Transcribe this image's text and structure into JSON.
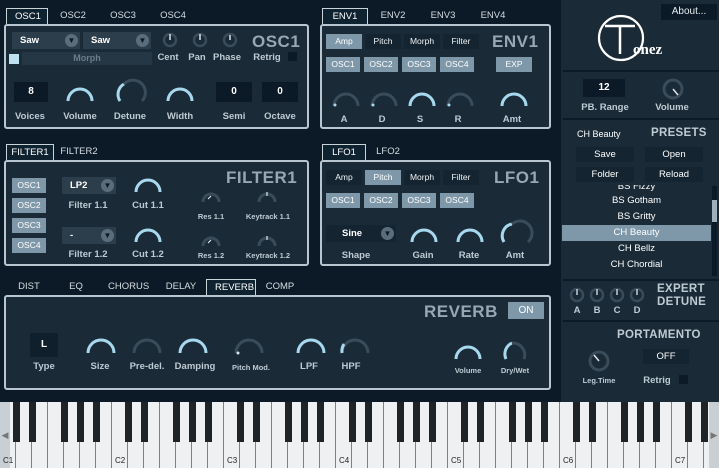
{
  "osc": {
    "tabs": [
      "OSC1",
      "OSC2",
      "OSC3",
      "OSC4"
    ],
    "title": "OSC1",
    "wave1": "Saw",
    "wave2": "Saw",
    "morph_label": "Morph",
    "knob_labels": [
      "Cent",
      "Pan",
      "Phase",
      "Retrig"
    ],
    "voices_value": "8",
    "semi_value": "0",
    "octave_value": "0",
    "bottom_labels": [
      "Voices",
      "Volume",
      "Detune",
      "Width",
      "Semi",
      "Octave"
    ]
  },
  "env": {
    "tabs": [
      "ENV1",
      "ENV2",
      "ENV3",
      "ENV4"
    ],
    "title": "ENV1",
    "targets": [
      "Amp",
      "Pitch",
      "Morph",
      "Filter"
    ],
    "oscs": [
      "OSC1",
      "OSC2",
      "OSC3",
      "OSC4"
    ],
    "exp": "EXP",
    "knob_labels": [
      "A",
      "D",
      "S",
      "R",
      "Amt"
    ]
  },
  "filter": {
    "tabs": [
      "FILTER1",
      "FILTER2"
    ],
    "title": "FILTER1",
    "oscs": [
      "OSC1",
      "OSC2",
      "OSC3",
      "OSC4"
    ],
    "type1": "LP2",
    "type2": "-",
    "labels": [
      "Filter 1.1",
      "Cut 1.1",
      "Res 1.1",
      "Keytrack 1.1",
      "Filter 1.2",
      "Cut 1.2",
      "Res 1.2",
      "Keytrack 1.2"
    ]
  },
  "lfo": {
    "tabs": [
      "LFO1",
      "LFO2"
    ],
    "title": "LFO1",
    "targets": [
      "Amp",
      "Pitch",
      "Morph",
      "Filter"
    ],
    "oscs": [
      "OSC1",
      "OSC2",
      "OSC3",
      "OSC4"
    ],
    "shape": "Sine",
    "labels": [
      "Shape",
      "Gain",
      "Rate",
      "Amt"
    ]
  },
  "fx": {
    "tabs": [
      "DIST",
      "EQ",
      "CHORUS",
      "DELAY",
      "REVERB",
      "COMP"
    ],
    "title": "REVERB",
    "on": "ON",
    "type_value": "L",
    "labels": [
      "Type",
      "Size",
      "Pre-del.",
      "Damping",
      "Pitch Mod.",
      "LPF",
      "HPF",
      "Volume",
      "Dry/Wet"
    ]
  },
  "side": {
    "about": "About...",
    "logo": "TONEZ",
    "pb_value": "12",
    "pb_label": "PB. Range",
    "volume_label": "Volume",
    "preset_name": "CH Beauty",
    "presets_title": "PRESETS",
    "buttons": [
      "Save",
      "Open",
      "Folder",
      "Reload"
    ],
    "preset_list": [
      "BS Fizzy",
      "BS Gotham",
      "BS Gritty",
      "CH Beauty",
      "CH Bellz",
      "CH Chordial"
    ],
    "expert_title_1": "EXPERT",
    "expert_title_2": "DETUNE",
    "detune_labels": [
      "A",
      "B",
      "C",
      "D"
    ],
    "porta_title": "PORTAMENTO",
    "porta_value": "OFF",
    "leg_time": "Leg.Time",
    "retrig": "Retrig"
  },
  "keyboard": {
    "notes": [
      "C1",
      "C2",
      "C3",
      "C4",
      "C5",
      "C6",
      "C7"
    ]
  }
}
